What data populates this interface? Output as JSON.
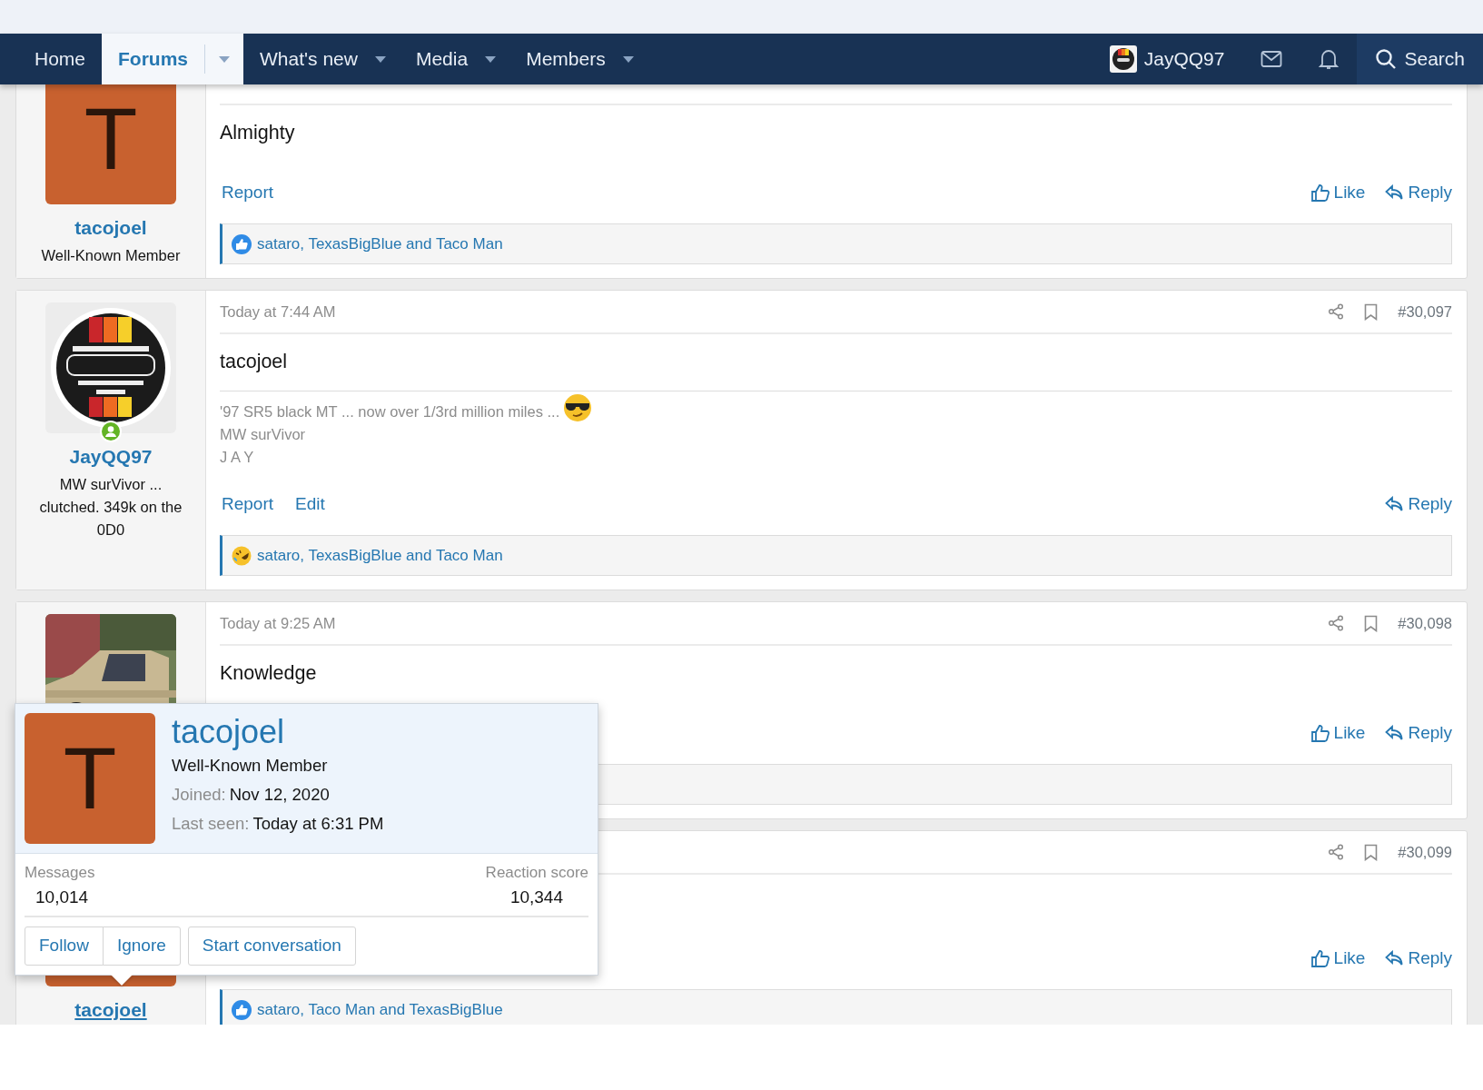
{
  "top_nav": {
    "items": [
      {
        "label": "Home",
        "selected": false
      },
      {
        "label": "Forums",
        "selected": true,
        "dropdown": true
      },
      {
        "label": "What's new",
        "selected": false,
        "dropdown": true
      },
      {
        "label": "Media",
        "selected": false,
        "dropdown": true
      },
      {
        "label": "Members",
        "selected": false,
        "dropdown": true
      }
    ],
    "account": "JayQQ97",
    "search": "Search"
  },
  "posts": [
    {
      "author": "tacojoel",
      "user_title": "Well-Known Member",
      "avatar": {
        "kind": "letter",
        "letter": "T",
        "color": "#c8612f"
      },
      "message": "Almighty",
      "links": [
        "Report"
      ],
      "actions": [
        {
          "kind": "like",
          "label": "Like"
        },
        {
          "kind": "reply",
          "label": "Reply"
        }
      ],
      "reactions": {
        "kind": "like",
        "text": "sataro, TexasBigBlue and Taco Man"
      }
    },
    {
      "author": "JayQQ97",
      "user_title": "MW surVivor ... clutched. 349k on the 0D0",
      "avatar": {
        "kind": "picture"
      },
      "online": true,
      "date": "Today at 7:44 AM",
      "number": "#30,097",
      "message": "tacojoel",
      "signature": [
        "'97 SR5 black MT ... now over 1/3rd million miles ...",
        "MW surVivor",
        "J A Y"
      ],
      "links": [
        "Report",
        "Edit"
      ],
      "actions": [
        {
          "kind": "reply",
          "label": "Reply"
        }
      ],
      "reactions": {
        "kind": "laugh",
        "text": "sataro, TexasBigBlue and Taco Man"
      }
    },
    {
      "avatar": {
        "kind": "picture"
      },
      "date": "Today at 9:25 AM",
      "number": "#30,098",
      "message": "Knowledge",
      "actions": [
        {
          "kind": "like",
          "label": "Like"
        },
        {
          "kind": "reply",
          "label": "Reply"
        }
      ],
      "reactions": {
        "kind": "hidden"
      }
    },
    {
      "author": "tacojoel",
      "author_hover": true,
      "avatar": {
        "kind": "letter",
        "color": "#c8612f"
      },
      "number": "#30,099",
      "actions": [
        {
          "kind": "like",
          "label": "Like"
        },
        {
          "kind": "reply",
          "label": "Reply"
        }
      ],
      "reactions": {
        "kind": "like",
        "text": "sataro, Taco Man and TexasBigBlue"
      }
    }
  ],
  "member_popup": {
    "avatar": {
      "letter": "T",
      "color": "#c8612f"
    },
    "name": "tacojoel",
    "user_title": "Well-Known Member",
    "facts": [
      {
        "label": "Joined:",
        "value": "Nov 12, 2020"
      },
      {
        "label": "Last seen:",
        "value": "Today at 6:31 PM"
      }
    ],
    "stats": [
      {
        "label": "Messages",
        "value": "10,014"
      },
      {
        "label": "Reaction score",
        "value": "10,344"
      }
    ],
    "buttons": [
      "Follow",
      "Ignore",
      "Start conversation"
    ]
  }
}
